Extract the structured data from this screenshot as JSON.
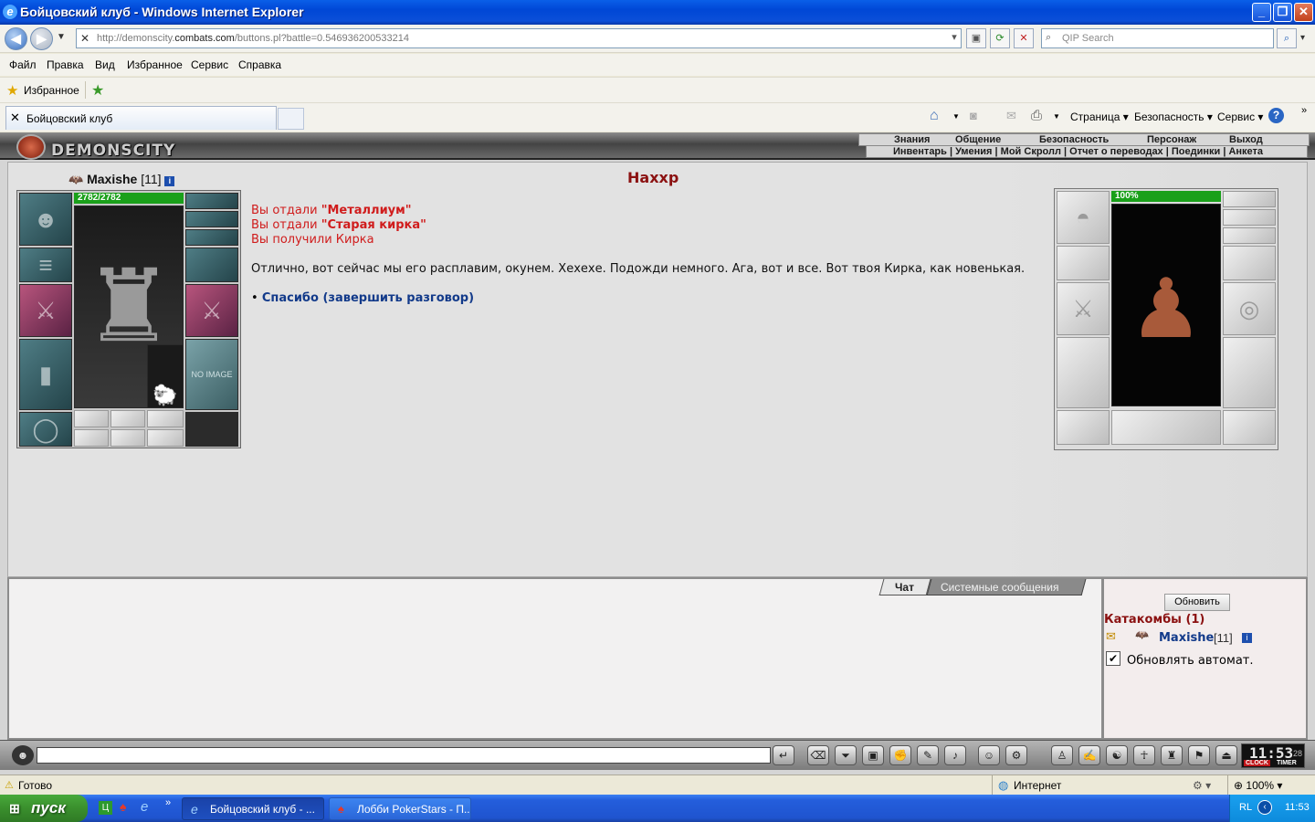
{
  "window": {
    "title": "Бойцовский клуб - Windows Internet Explorer",
    "min": "_",
    "max": "❐",
    "close": "✕"
  },
  "nav": {
    "url_prefix": "http://demonscity.",
    "url_host": "combats.com",
    "url_rest": "/buttons.pl?battle=0.546936200533214",
    "search_placeholder": "QIP Search"
  },
  "menu": [
    "Файл",
    "Правка",
    "Вид",
    "Избранное",
    "Сервис",
    "Справка"
  ],
  "favorites": {
    "label": "Избранное"
  },
  "tab": {
    "title": "Бойцовский клуб"
  },
  "commandbar": [
    "Страница ▾",
    "Безопасность ▾",
    "Сервис ▾",
    "?"
  ],
  "site": {
    "logo": "DEMONSCITY",
    "top_menu": [
      "Знания",
      "Общение",
      "Безопасность",
      "Персонаж",
      "Выход"
    ],
    "sub_menu": "Инвентарь | Умения | Мой Скролл | Отчет о переводах | Поединки | Анкета"
  },
  "player": {
    "name": "Maxishe",
    "level": "[11]",
    "info": "i",
    "hp": "2782/2782",
    "hp_fraction": 1.0,
    "no_image": "NO IMAGE"
  },
  "npc": {
    "name": "Нахxр",
    "hp": "100%",
    "hp_fraction": 1.0
  },
  "dialog": {
    "gave1_prefix": "Вы отдали ",
    "gave1_item": "\"Металлиум\"",
    "gave2_prefix": "Вы отдали ",
    "gave2_item": "\"Старая кирка\"",
    "received": "Вы получили Кирка",
    "speech": "Отлично, вот сейчас мы его расплавим, окунем. Хехехе. Подожди немного. Ага, вот и все. Вот твоя Кирка, как новенькая.",
    "bullet": "•",
    "option": "Спасибо (завершить разговор)"
  },
  "chat": {
    "tab_chat": "Чат",
    "tab_system": "Системные сообщения"
  },
  "online": {
    "refresh": "Обновить",
    "location": "Катакомбы (1)",
    "user_name": "Maxishe",
    "user_level": "[11]",
    "auto_refresh": "Обновлять автомат.",
    "auto_refresh_checked": true
  },
  "clock": {
    "time": "11:53",
    "seconds": "28",
    "clock_label": "CLOCK",
    "timer_label": "TIMER"
  },
  "statusbar": {
    "ready": "Готово",
    "zone": "Интернет",
    "zoom": "100%"
  },
  "taskbar": {
    "start": "пуск",
    "task1": "Бойцовский клуб - ...",
    "task2": "Лобби PokerStars - П...",
    "lang": "RL",
    "time": "11:53"
  }
}
